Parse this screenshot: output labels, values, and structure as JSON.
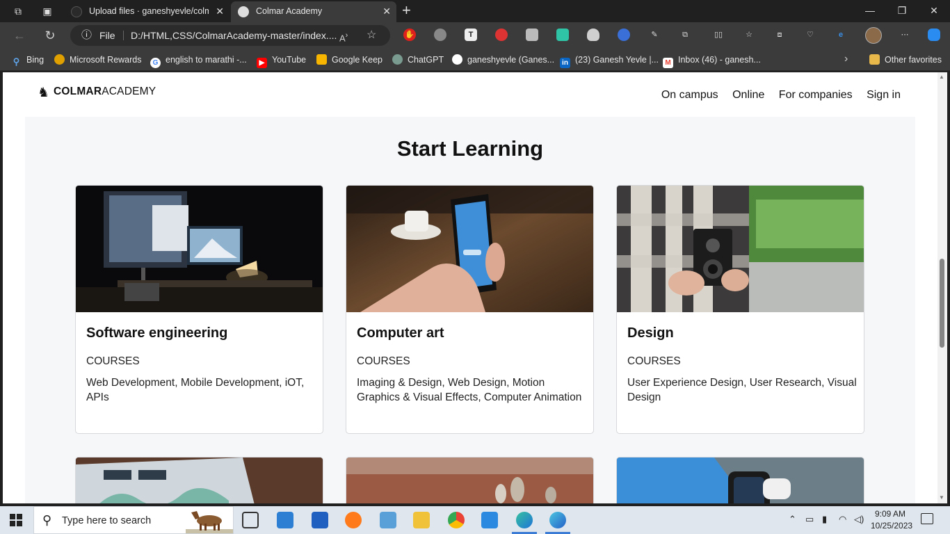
{
  "browser": {
    "tabs": [
      {
        "title": "Upload files · ganeshyevle/colmar-academy",
        "active": false
      },
      {
        "title": "Colmar Academy",
        "active": true
      }
    ],
    "address": {
      "scheme_label": "File",
      "url": "D:/HTML,CSS/ColmarAcademy-master/index...."
    },
    "favorites": [
      {
        "label": "Bing",
        "icon": "bing-search-icon",
        "color": "#2b7cd3"
      },
      {
        "label": "Microsoft Rewards",
        "icon": "rewards-medal-icon",
        "color": "#e0a100"
      },
      {
        "label": "english to marathi -...",
        "icon": "google-icon",
        "color": "#4285f4"
      },
      {
        "label": "YouTube",
        "icon": "youtube-icon",
        "color": "#ff0000"
      },
      {
        "label": "Google Keep",
        "icon": "google-keep-icon",
        "color": "#f7b500"
      },
      {
        "label": "ChatGPT",
        "icon": "chatgpt-icon",
        "color": "#19c37d"
      },
      {
        "label": "ganeshyevle (Ganes...",
        "icon": "github-icon",
        "color": "#ffffff"
      },
      {
        "label": "(23) Ganesh Yevle |...",
        "icon": "linkedin-icon",
        "color": "#0a66c2"
      },
      {
        "label": "Inbox (46) - ganesh...",
        "icon": "gmail-icon",
        "color": "#ea4335"
      }
    ],
    "other_favorites": "Other favorites"
  },
  "site": {
    "logo_bold": "COLMAR",
    "logo_light": "ACADEMY",
    "nav": [
      "On campus",
      "Online",
      "For companies",
      "Sign in"
    ],
    "section_title": "Start Learning",
    "cards": [
      {
        "title": "Software engineering",
        "label": "COURSES",
        "desc": "Web Development, Mobile Development, iOT, APIs",
        "image": "desk-computer-photo"
      },
      {
        "title": "Computer art",
        "label": "COURSES",
        "desc": "Imaging & Design, Web Design, Motion Graphics & Visual Effects, Computer Animation",
        "image": "phone-in-hand-photo"
      },
      {
        "title": "Design",
        "label": "COURSES",
        "desc": "User Experience Design, User Research, Visual Design",
        "image": "vintage-camera-photo"
      }
    ]
  },
  "taskbar": {
    "search_placeholder": "Type here to search",
    "time": "9:09 AM",
    "date": "10/25/2023"
  }
}
